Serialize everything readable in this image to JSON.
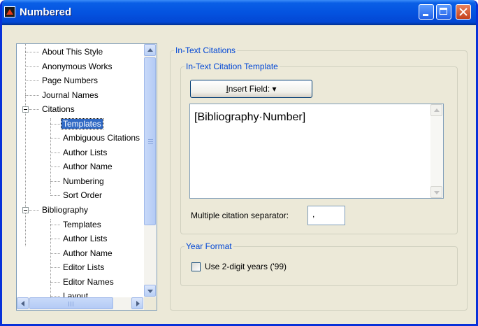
{
  "window": {
    "title": "Numbered"
  },
  "tree": {
    "items": [
      {
        "label": "About This Style"
      },
      {
        "label": "Anonymous Works"
      },
      {
        "label": "Page Numbers"
      },
      {
        "label": "Journal Names"
      },
      {
        "label": "Citations",
        "expanded": true
      },
      {
        "label": "Templates",
        "selected": true
      },
      {
        "label": "Ambiguous Citations"
      },
      {
        "label": "Author Lists"
      },
      {
        "label": "Author Name"
      },
      {
        "label": "Numbering"
      },
      {
        "label": "Sort Order"
      },
      {
        "label": "Bibliography",
        "expanded": true
      },
      {
        "label": "Templates"
      },
      {
        "label": "Author Lists"
      },
      {
        "label": "Author Name"
      },
      {
        "label": "Editor Lists"
      },
      {
        "label": "Editor Names"
      },
      {
        "label": "Layout"
      }
    ]
  },
  "main": {
    "group_citations": "In-Text Citations",
    "group_template": "In-Text Citation Template",
    "insert_field_prefix": "I",
    "insert_field_rest": "nsert Field:",
    "insert_field_arrow": "▾",
    "template_text": "[Bibliography·Number]",
    "separator_label": "Multiple citation separator:",
    "separator_value": ",",
    "group_year": "Year Format",
    "year_checkbox_label": "Use 2-digit years ('99)",
    "year_checkbox_checked": false
  },
  "icons": {
    "app": "endnote-style-icon",
    "minimize": "minimize-icon",
    "maximize": "maximize-icon",
    "close": "close-icon"
  },
  "colors": {
    "titlebar": "#0453e0",
    "selection": "#316ac5",
    "groupbox_text": "#0046d5",
    "dialog_bg": "#ece9d8"
  }
}
